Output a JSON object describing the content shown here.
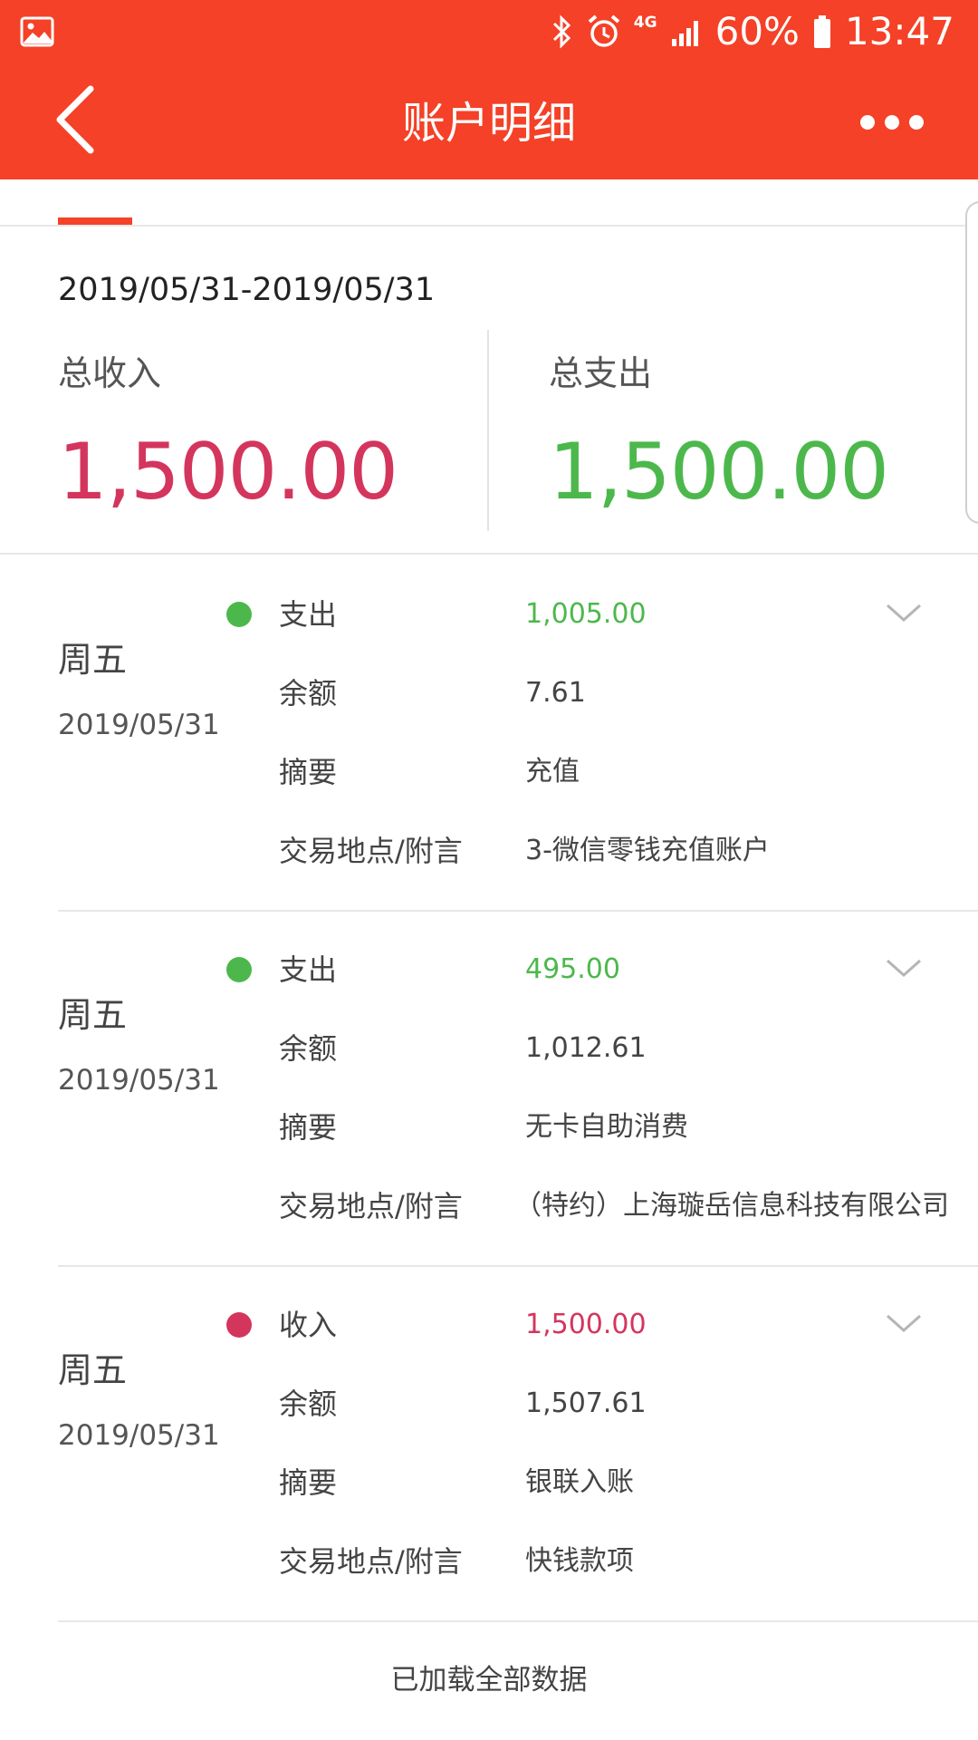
{
  "status_bar": {
    "battery": "60%",
    "time": "13:47",
    "network": "4G",
    "icons": [
      "gallery-icon",
      "bluetooth-icon",
      "alarm-icon",
      "signal-icon",
      "battery-icon"
    ]
  },
  "header": {
    "title": "账户明细",
    "back_icon": "back-arrow-icon",
    "more_icon": "more-icon"
  },
  "summary": {
    "date_range": "2019/05/31-2019/05/31",
    "income_label": "总收入",
    "income_value": "1,500.00",
    "expense_label": "总支出",
    "expense_value": "1,500.00"
  },
  "labels": {
    "balance": "余额",
    "summary": "摘要",
    "location": "交易地点/附言"
  },
  "transactions": [
    {
      "weekday": "周五",
      "date": "2019/05/31",
      "type": "支出",
      "amount": "1,005.00",
      "balance": "7.61",
      "summary": "充值",
      "location": "3-微信零钱充值账户",
      "color": "#4cb84c"
    },
    {
      "weekday": "周五",
      "date": "2019/05/31",
      "type": "支出",
      "amount": "495.00",
      "balance": "1,012.61",
      "summary": "无卡自助消费",
      "location": "（特约）上海璇岳信息科技有限公司",
      "color": "#4cb84c"
    },
    {
      "weekday": "周五",
      "date": "2019/05/31",
      "type": "收入",
      "amount": "1,500.00",
      "balance": "1,507.61",
      "summary": "银联入账",
      "location": "快钱款项",
      "color": "#d4355d"
    }
  ],
  "footer": {
    "loaded_all": "已加载全部数据"
  },
  "colors": {
    "brand": "#f44127",
    "income": "#d4355d",
    "expense": "#4cb84c"
  }
}
